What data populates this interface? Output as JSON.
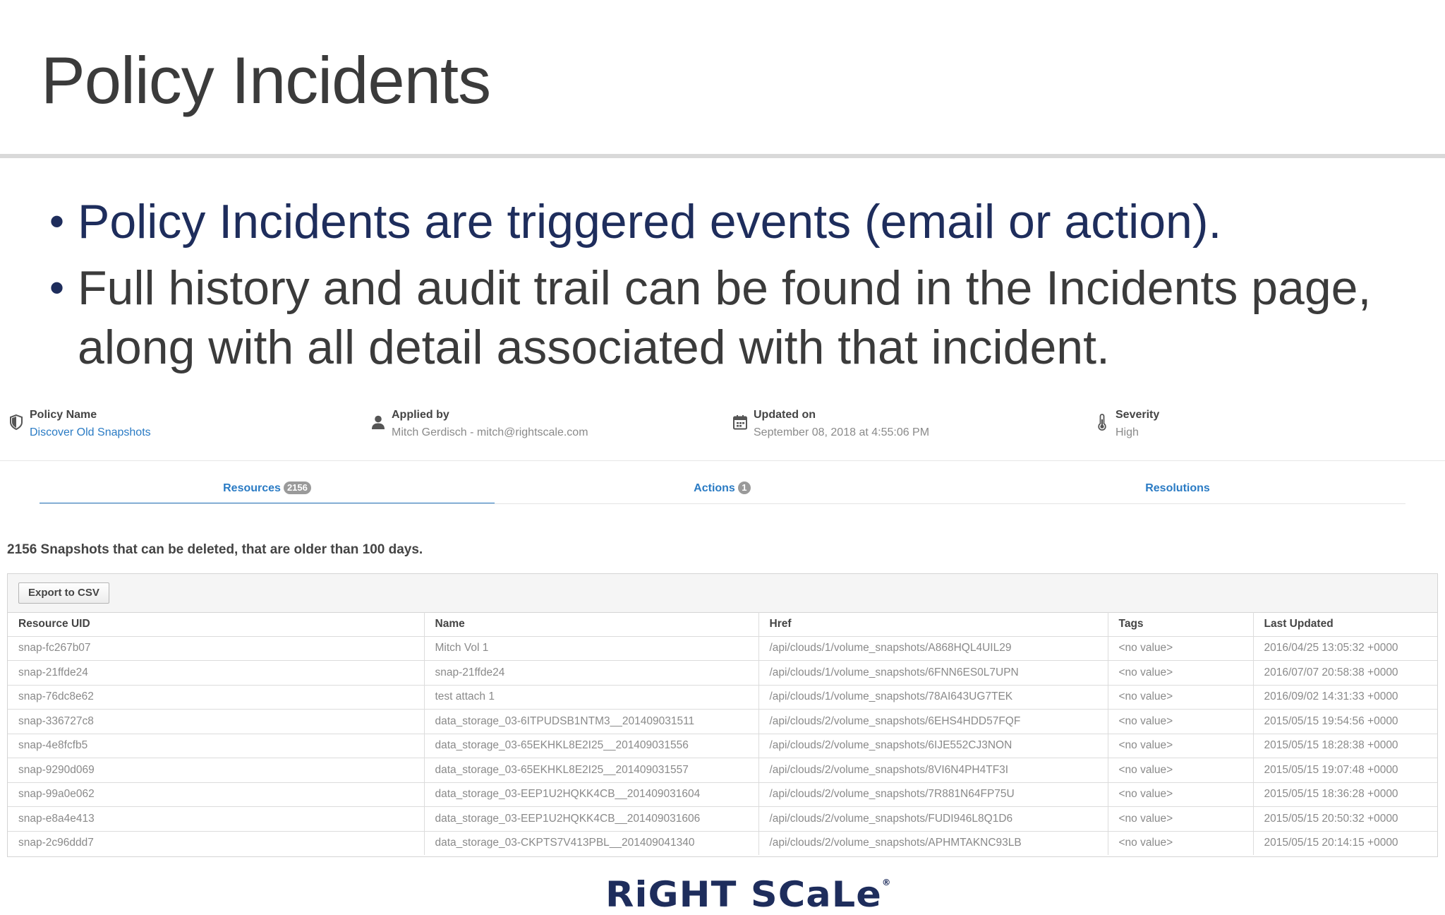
{
  "slide": {
    "title": "Policy Incidents",
    "bullets": [
      "Policy Incidents are triggered events (email or action).",
      "Full history and audit trail can be found in the Incidents page,",
      "along with all detail associated with that incident."
    ]
  },
  "meta": [
    {
      "icon": "shield-icon",
      "label": "Policy Name",
      "value": "Discover Old Snapshots"
    },
    {
      "icon": "user-icon",
      "label": "Applied by",
      "value": "Mitch Gerdisch - mitch@rightscale.com"
    },
    {
      "icon": "calendar-icon",
      "label": "Updated on",
      "value": "September 08, 2018 at 4:55:06 PM"
    },
    {
      "icon": "thermometer-icon",
      "label": "Severity",
      "value": "High"
    }
  ],
  "tabs": [
    {
      "label": "Resources",
      "badge": "2156",
      "active": true
    },
    {
      "label": "Actions",
      "badge": "1",
      "active": false
    },
    {
      "label": "Resolutions",
      "badge": "",
      "active": false
    }
  ],
  "summary": "2156 Snapshots that can be deleted, that are older than 100 days.",
  "toolbar": {
    "export_label": "Export to CSV"
  },
  "table": {
    "columns": [
      "Resource UID",
      "Name",
      "Href",
      "Tags",
      "Last Updated"
    ],
    "rows": [
      [
        "snap-fc267b07",
        "Mitch Vol 1",
        "/api/clouds/1/volume_snapshots/A868HQL4UIL29",
        "<no value>",
        "2016/04/25 13:05:32 +0000"
      ],
      [
        "snap-21ffde24",
        "snap-21ffde24",
        "/api/clouds/1/volume_snapshots/6FNN6ES0L7UPN",
        "<no value>",
        "2016/07/07 20:58:38 +0000"
      ],
      [
        "snap-76dc8e62",
        "test attach 1",
        "/api/clouds/1/volume_snapshots/78AI643UG7TEK",
        "<no value>",
        "2016/09/02 14:31:33 +0000"
      ],
      [
        "snap-336727c8",
        "data_storage_03-6ITPUDSB1NTM3__201409031511",
        "/api/clouds/2/volume_snapshots/6EHS4HDD57FQF",
        "<no value>",
        "2015/05/15 19:54:56 +0000"
      ],
      [
        "snap-4e8fcfb5",
        "data_storage_03-65EKHKL8E2I25__201409031556",
        "/api/clouds/2/volume_snapshots/6IJE552CJ3NON",
        "<no value>",
        "2015/05/15 18:28:38 +0000"
      ],
      [
        "snap-9290d069",
        "data_storage_03-65EKHKL8E2I25__201409031557",
        "/api/clouds/2/volume_snapshots/8VI6N4PH4TF3I",
        "<no value>",
        "2015/05/15 19:07:48 +0000"
      ],
      [
        "snap-99a0e062",
        "data_storage_03-EEP1U2HQKK4CB__201409031604",
        "/api/clouds/2/volume_snapshots/7R881N64FP75U",
        "<no value>",
        "2015/05/15 18:36:28 +0000"
      ],
      [
        "snap-e8a4e413",
        "data_storage_03-EEP1U2HQKK4CB__201409031606",
        "/api/clouds/2/volume_snapshots/FUDI946L8Q1D6",
        "<no value>",
        "2015/05/15 20:50:32 +0000"
      ],
      [
        "snap-2c96ddd7",
        "data_storage_03-CKPTS7V413PBL__201409041340",
        "/api/clouds/2/volume_snapshots/APHMTAKNC93LB",
        "<no value>",
        "2015/05/15 20:14:15 +0000"
      ]
    ]
  },
  "logo": {
    "text": "RiGHT SCaLe",
    "mark": "®"
  },
  "colors": {
    "title": "#3b3b3b",
    "bullet_primary": "#1e2d5c",
    "link": "#2a7bc4",
    "muted": "#8a8a8a"
  }
}
